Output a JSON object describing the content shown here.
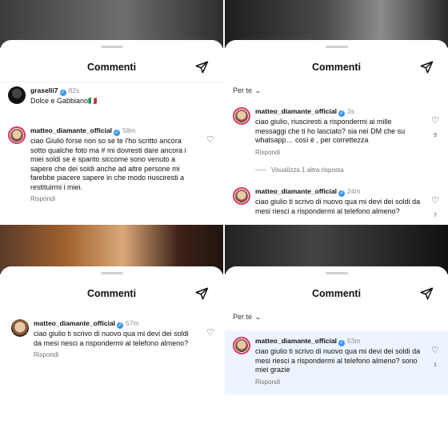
{
  "panel1": {
    "title": "Commenti",
    "comments": [
      {
        "username": "graselli7",
        "verified": true,
        "time": "82s",
        "text": "Dolce e Gabbiano🇮🇹",
        "reply": ""
      },
      {
        "username": "matteo_diamante_official",
        "verified": true,
        "time": "58m",
        "text": "ciao Giulio forse non so se te l'ho scritto ancora sotto qualche foto ma # mi dovresti dare ancora i miei soldi se è sparito siccome sono venuto a sapere che dei soldi anche ad altre persone mi farebbe piacere sapere in che modo riusciresti a restituirmi i miei.",
        "reply": "Rispondi"
      }
    ]
  },
  "panel2": {
    "title": "Commenti",
    "sort_label": "Per te",
    "comments": [
      {
        "username": "matteo_diamante_official",
        "verified": true,
        "time": "3s",
        "text": "ciao giulio, riusciresti a rispondermi ai mille messaggi che ti ho lasciato? sia nei DM che su whatsapp… così è , per correttezza",
        "reply": "Rispondi",
        "likes": "9"
      },
      {
        "username": "matteo_diamante_official",
        "verified": true,
        "time": "24m",
        "text": "ciao giulio ti scrivo di nuovo qua mi devi dei soldi da mesi riesci a rispondermi al telefono almeno?",
        "reply": "",
        "likes": "7"
      }
    ],
    "view_replies": "Visualizza 1 altra risposta"
  },
  "panel3": {
    "title": "Commenti",
    "comments": [
      {
        "username": "matteo_diamante_official",
        "verified": true,
        "time": "57m",
        "text": "ciao giulio ti scrivo di nuovo qua mi devi dei soldi da mesi riesci a rispondermi al telefono almeno?",
        "reply": "Rispondi"
      }
    ]
  },
  "panel4": {
    "title": "Commenti",
    "sort_label": "Per te",
    "comments": [
      {
        "username": "matteo_diamante_official",
        "verified": true,
        "time": "53m",
        "text": "ciao giulio ti scrivo di nuovo qua mi devi dei soldi da mesi riesci a rispondermi al telefono almeno? sono miei grazie",
        "reply": "Rispondi",
        "likes": "1"
      }
    ]
  },
  "icons": {
    "send": "send-icon",
    "heart": "heart-outline-icon",
    "verified": "verified-badge-icon",
    "chevron": "chevron-down-icon"
  },
  "colors": {
    "verified": "#3897f0",
    "highlight": "#eef4ff",
    "muted": "#737373"
  }
}
